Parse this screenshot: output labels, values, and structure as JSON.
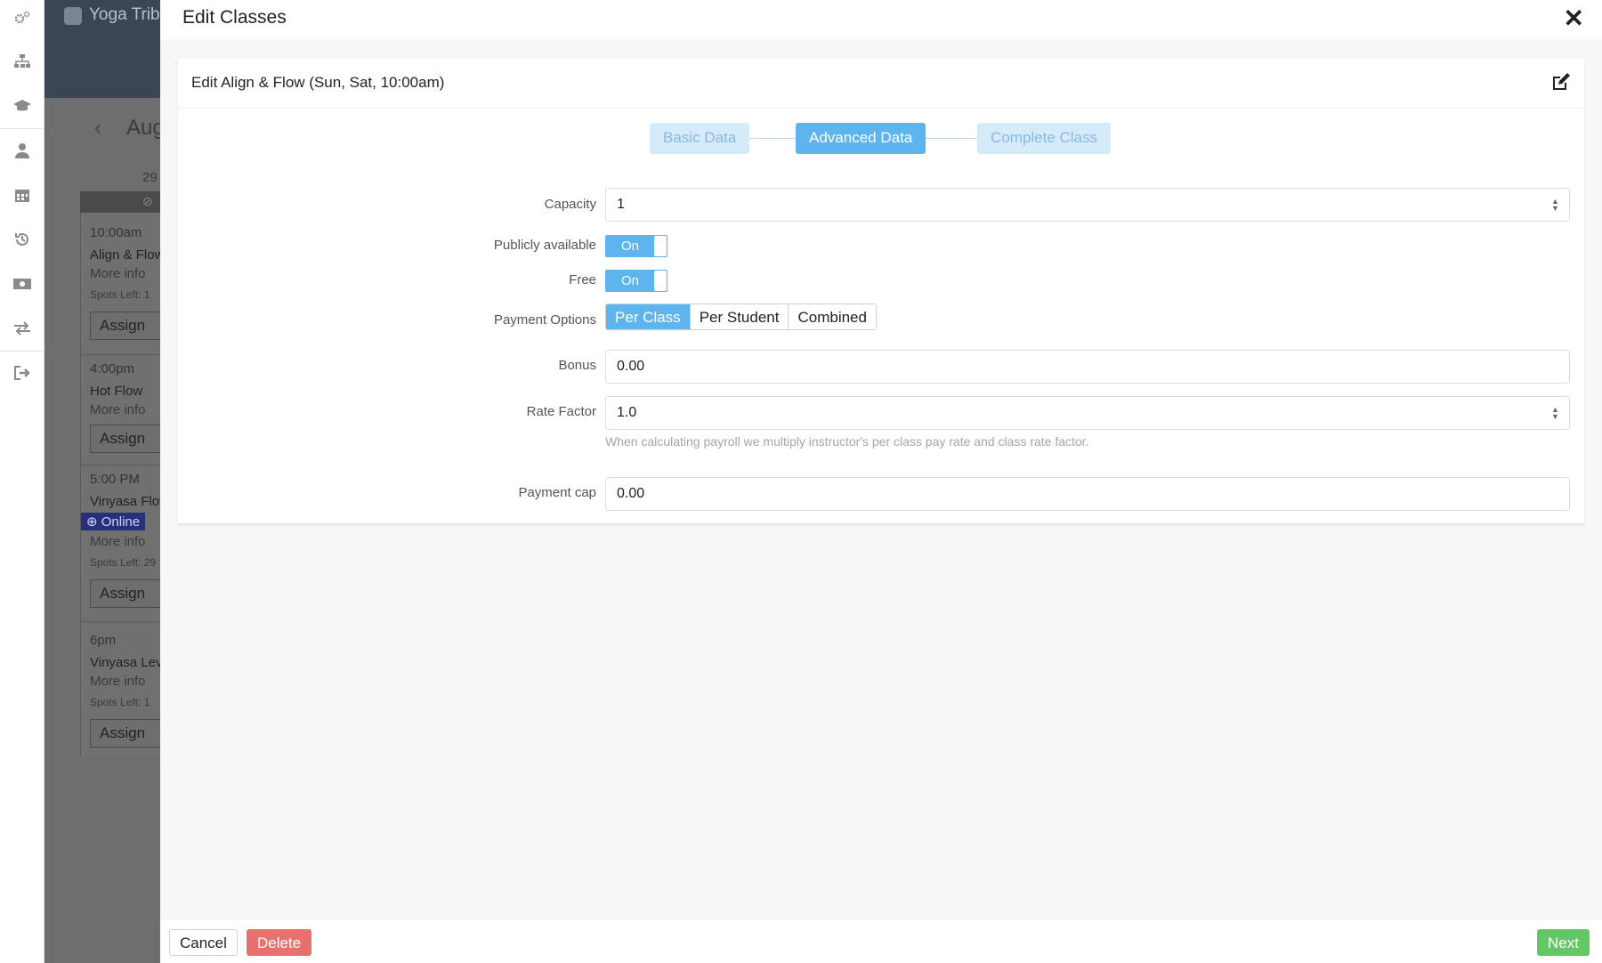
{
  "background_app": {
    "brand": "Yoga Tribe",
    "month_label": "Aug",
    "day_number": "29",
    "events": [
      {
        "time": "10:00am",
        "name": "Align & Flow",
        "more": "More info",
        "spots": "Spots Left: 1",
        "assign": "Assign",
        "online": ""
      },
      {
        "time": "4:00pm",
        "name": "Hot Flow",
        "more": "More info",
        "spots": "",
        "assign": "Assign",
        "online": ""
      },
      {
        "time": "5:00 PM",
        "name": "Vinyasa Flow",
        "more": "More info",
        "spots": "Spots Left: 29",
        "assign": "Assign",
        "online": "Online"
      },
      {
        "time": "6pm",
        "name": "Vinyasa Level",
        "more": "More info",
        "spots": "Spots Left: 1",
        "assign": "Assign",
        "online": ""
      }
    ]
  },
  "modal": {
    "title": "Edit Classes",
    "close_icon": "close-icon"
  },
  "card": {
    "title": "Edit Align & Flow (Sun, Sat, 10:00am)",
    "edit_icon": "edit-icon"
  },
  "steps": [
    {
      "label": "Basic Data",
      "state": "inactive"
    },
    {
      "label": "Advanced Data",
      "state": "active"
    },
    {
      "label": "Complete Class",
      "state": "inactive"
    }
  ],
  "form": {
    "capacity": {
      "label": "Capacity",
      "value": "1"
    },
    "publicly_available": {
      "label": "Publicly available",
      "toggle_text": "On"
    },
    "free": {
      "label": "Free",
      "toggle_text": "On"
    },
    "payment_options": {
      "label": "Payment Options",
      "options": [
        "Per Class",
        "Per Student",
        "Combined"
      ],
      "selected": "Per Class"
    },
    "bonus": {
      "label": "Bonus",
      "value": "0.00"
    },
    "rate_factor": {
      "label": "Rate Factor",
      "value": "1.0",
      "help": "When calculating payroll we multiply instructor's per class pay rate and class rate factor."
    },
    "payment_cap": {
      "label": "Payment cap",
      "value": "0.00"
    }
  },
  "footer": {
    "cancel_label": "Cancel",
    "delete_label": "Delete",
    "next_label": "Next"
  },
  "colors": {
    "accent": "#5eb4ec",
    "delete": "#e8716d",
    "next": "#63c766"
  }
}
